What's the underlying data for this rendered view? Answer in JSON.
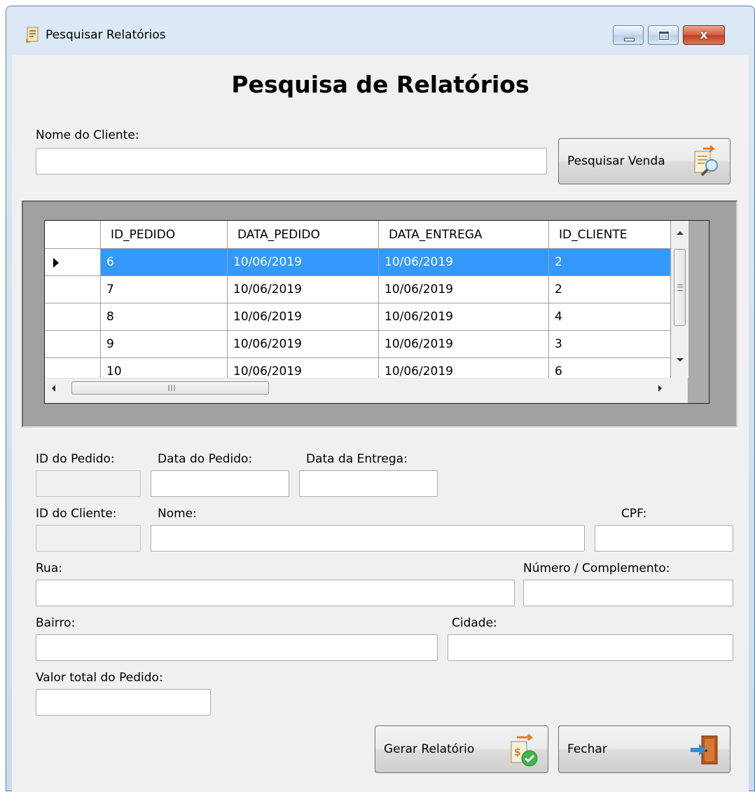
{
  "window": {
    "title": "Pesquisar Relatórios",
    "minimize_icon": "minimize-icon",
    "maximize_icon": "maximize-icon",
    "close_glyph": "x"
  },
  "form": {
    "heading": "Pesquisa de Relatórios",
    "client_name_label": "Nome do Cliente:",
    "client_name_value": "",
    "search_button_label": "Pesquisar Venda"
  },
  "grid": {
    "columns": [
      "ID_PEDIDO",
      "DATA_PEDIDO",
      "DATA_ENTREGA",
      "ID_CLIENTE"
    ],
    "rows": [
      {
        "id_pedido": "6",
        "data_pedido": "10/06/2019",
        "data_entrega": "10/06/2019",
        "id_cliente": "2",
        "selected": true
      },
      {
        "id_pedido": "7",
        "data_pedido": "10/06/2019",
        "data_entrega": "10/06/2019",
        "id_cliente": "2",
        "selected": false
      },
      {
        "id_pedido": "8",
        "data_pedido": "10/06/2019",
        "data_entrega": "10/06/2019",
        "id_cliente": "4",
        "selected": false
      },
      {
        "id_pedido": "9",
        "data_pedido": "10/06/2019",
        "data_entrega": "10/06/2019",
        "id_cliente": "3",
        "selected": false
      },
      {
        "id_pedido": "10",
        "data_pedido": "10/06/2019",
        "data_entrega": "10/06/2019",
        "id_cliente": "6",
        "selected": false
      }
    ],
    "selection_color": "#3399ff"
  },
  "details": {
    "order_id_label": "ID do Pedido:",
    "order_date_label": "Data do Pedido:",
    "delivery_date_label": "Data da Entrega:",
    "client_id_label": "ID do Cliente:",
    "name_label": "Nome:",
    "cpf_label": "CPF:",
    "street_label": "Rua:",
    "number_label": "Número / Complemento:",
    "district_label": "Bairro:",
    "city_label": "Cidade:",
    "total_label": "Valor total do Pedido:"
  },
  "actions": {
    "report_button_label": "Gerar Relatório",
    "close_button_label": "Fechar"
  },
  "colors": {
    "window_frame": "#c9dbee",
    "client_bg": "#f0f0f0",
    "grid_panel_bg": "#a0a0a0",
    "close_button": "#c8452b"
  }
}
